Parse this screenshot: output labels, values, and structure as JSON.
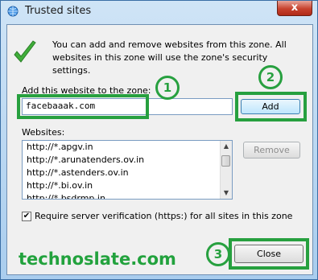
{
  "window": {
    "title": "Trusted sites",
    "close_glyph": "x"
  },
  "info": {
    "message": "You can add and remove websites from this zone. All websites in this zone will use the zone's security settings."
  },
  "add_section": {
    "label": "Add this website to the zone:",
    "url_value": "facebaaak.com",
    "add_button": "Add"
  },
  "websites_section": {
    "label": "Websites:",
    "items": [
      "http://*.apgv.in",
      "http://*.arunatenders.ov.in",
      "http://*.astenders.ov.in",
      "http://*.bi.ov.in",
      "http://*.bsdrmp.in"
    ],
    "remove_button": "Remove"
  },
  "verification": {
    "checked": true,
    "label": "Require server verification (https:) for all sites in this zone"
  },
  "close_button": "Close",
  "annotations": {
    "step1": "1",
    "step2": "2",
    "step3": "3",
    "highlight_color": "#27a03f"
  },
  "watermark": "technoslate.com"
}
